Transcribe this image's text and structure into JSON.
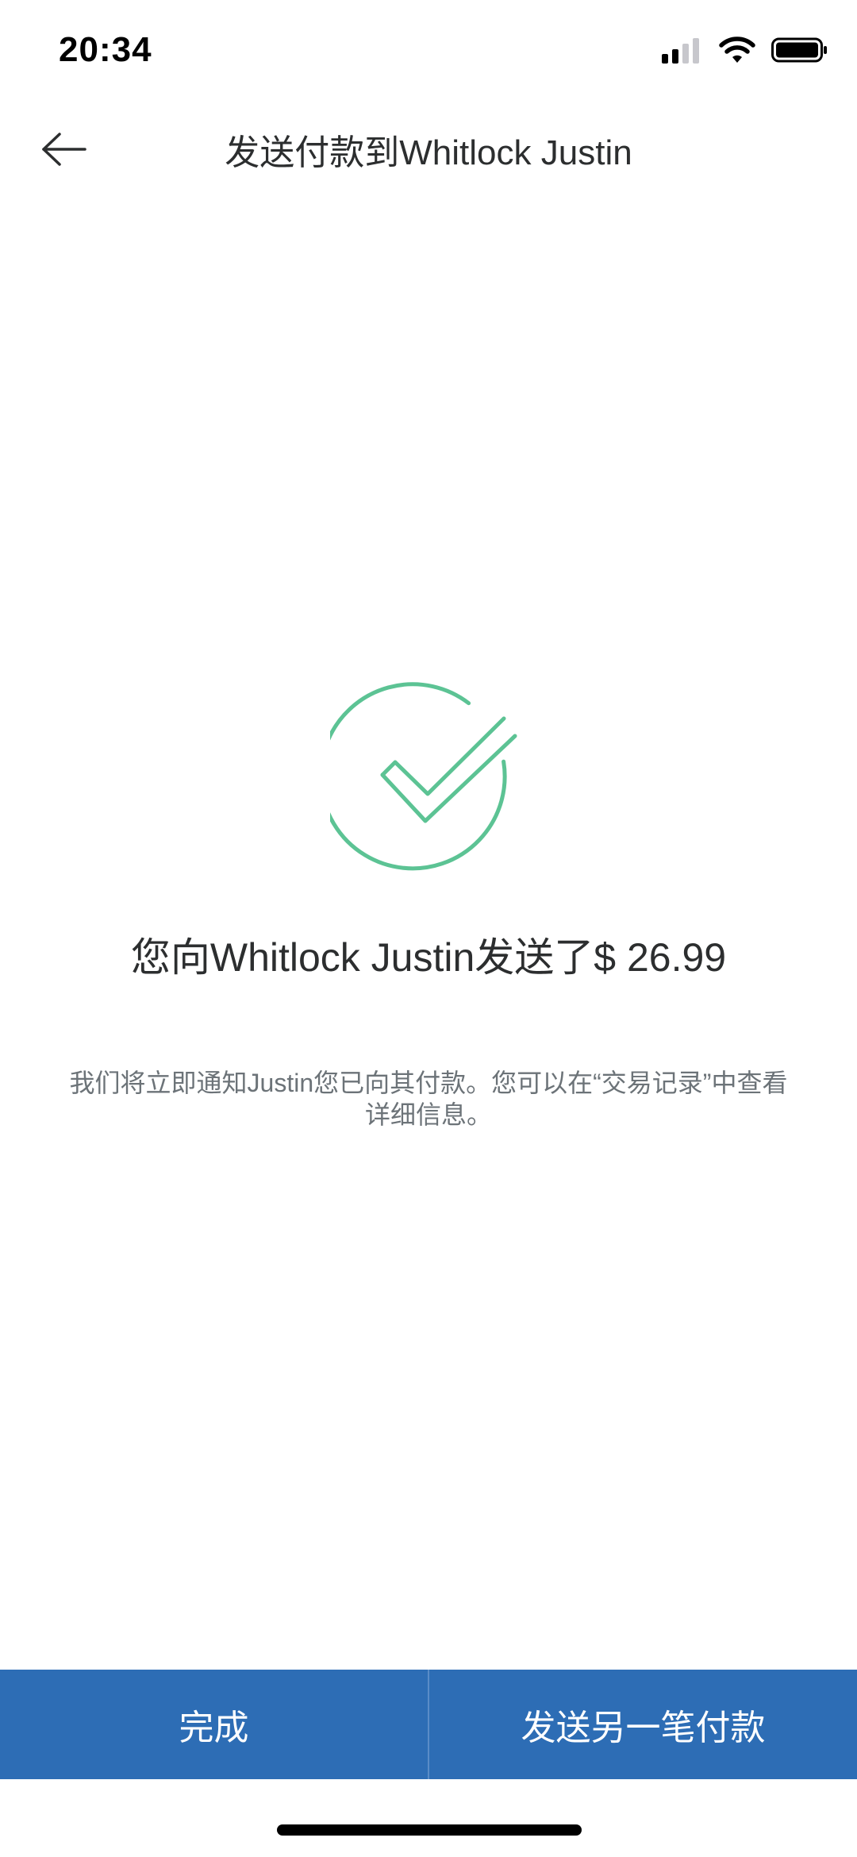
{
  "status_bar": {
    "time": "20:34",
    "icons": [
      "signal-icon",
      "wifi-icon",
      "battery-icon"
    ]
  },
  "header": {
    "back_icon": "back-arrow-icon",
    "title": "发送付款到Whitlock Justin"
  },
  "success": {
    "icon": "checkmark-circle-icon",
    "title": "您向Whitlock Justin发送了$ 26.99",
    "description_line1": "我们将立即通知Justin您已向其付款。您可以在“交易记录”中查看",
    "description_line2": "详细信息。"
  },
  "actions": {
    "done_label": "完成",
    "send_another_label": "发送另一笔付款"
  },
  "colors": {
    "accent_green": "#5cc394",
    "button_blue": "#2d6db5",
    "text_dark": "#2c2e2f",
    "text_muted": "#6c7378"
  }
}
